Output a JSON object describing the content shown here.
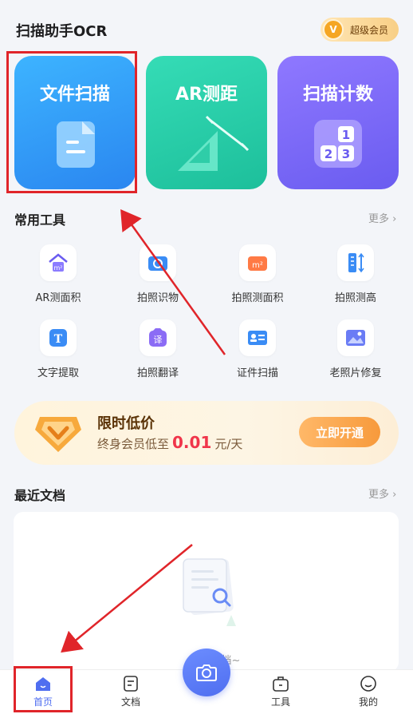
{
  "header": {
    "title": "扫描助手OCR",
    "vip_label": "超级会员"
  },
  "feature_cards": [
    {
      "label": "文件扫描"
    },
    {
      "label": "AR测距"
    },
    {
      "label": "扫描计数"
    }
  ],
  "tools_section": {
    "title": "常用工具",
    "more": "更多"
  },
  "tools": [
    {
      "label": "AR测面积"
    },
    {
      "label": "拍照识物"
    },
    {
      "label": "拍照测面积"
    },
    {
      "label": "拍照测高"
    },
    {
      "label": "文字提取"
    },
    {
      "label": "拍照翻译"
    },
    {
      "label": "证件扫描"
    },
    {
      "label": "老照片修复"
    }
  ],
  "promo": {
    "title": "限时低价",
    "prefix": "终身会员低至",
    "price": "0.01",
    "unit": "元/天",
    "button": "立即开通"
  },
  "recent_section": {
    "title": "最近文档",
    "more": "更多",
    "empty_text": "暂无文档~"
  },
  "tabs": [
    {
      "label": "首页"
    },
    {
      "label": "文档"
    },
    {
      "label": "工具"
    },
    {
      "label": "我的"
    }
  ],
  "colors": {
    "accent": "#4f6ef0",
    "highlight": "#e0252a",
    "price": "#f0354a"
  }
}
